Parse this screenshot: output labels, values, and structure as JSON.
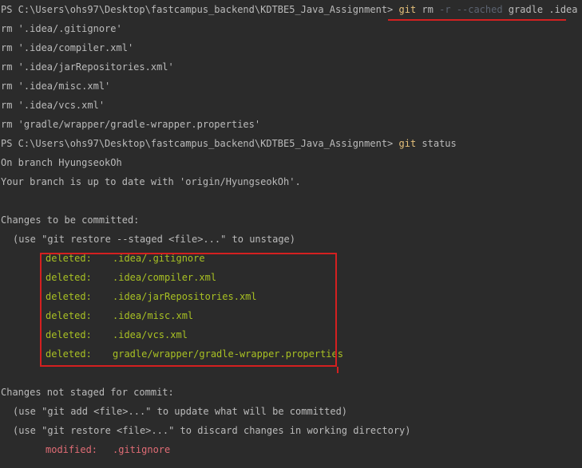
{
  "prompt": "PS C:\\Users\\ohs97\\Desktop\\fastcampus_backend\\KDTBE5_Java_Assignment> ",
  "cmd1": {
    "git": "git",
    "rm": " rm ",
    "flags": "-r --cached",
    "args": " gradle .idea"
  },
  "rm_lines": [
    "rm '.idea/.gitignore'",
    "rm '.idea/compiler.xml'",
    "rm '.idea/jarRepositories.xml'",
    "rm '.idea/misc.xml'",
    "rm '.idea/vcs.xml'",
    "rm 'gradle/wrapper/gradle-wrapper.properties'"
  ],
  "cmd2": {
    "git": "git",
    "rest": " status"
  },
  "status": {
    "branch_line": "On branch HyungseokOh",
    "uptodate_line": "Your branch is up to date with 'origin/HyungseokOh'.",
    "staged_header": "Changes to be committed:",
    "staged_hint": "(use \"git restore --staged <file>...\" to unstage)",
    "deleted_label": "deleted:",
    "deleted_files": [
      ".idea/.gitignore",
      ".idea/compiler.xml",
      ".idea/jarRepositories.xml",
      ".idea/misc.xml",
      ".idea/vcs.xml",
      "gradle/wrapper/gradle-wrapper.properties"
    ],
    "unstaged_header": "Changes not staged for commit:",
    "unstaged_hint1": "(use \"git add <file>...\" to update what will be committed)",
    "unstaged_hint2": "(use \"git restore <file>...\" to discard changes in working directory)",
    "modified_label": "modified:",
    "modified_file": ".gitignore"
  },
  "colors": {
    "background": "#2b2b2b",
    "text": "#bbbbbb",
    "git_keyword": "#e5c07b",
    "staged": "#a8c023",
    "unstaged": "#e06c75",
    "annotation": "#d42020"
  }
}
